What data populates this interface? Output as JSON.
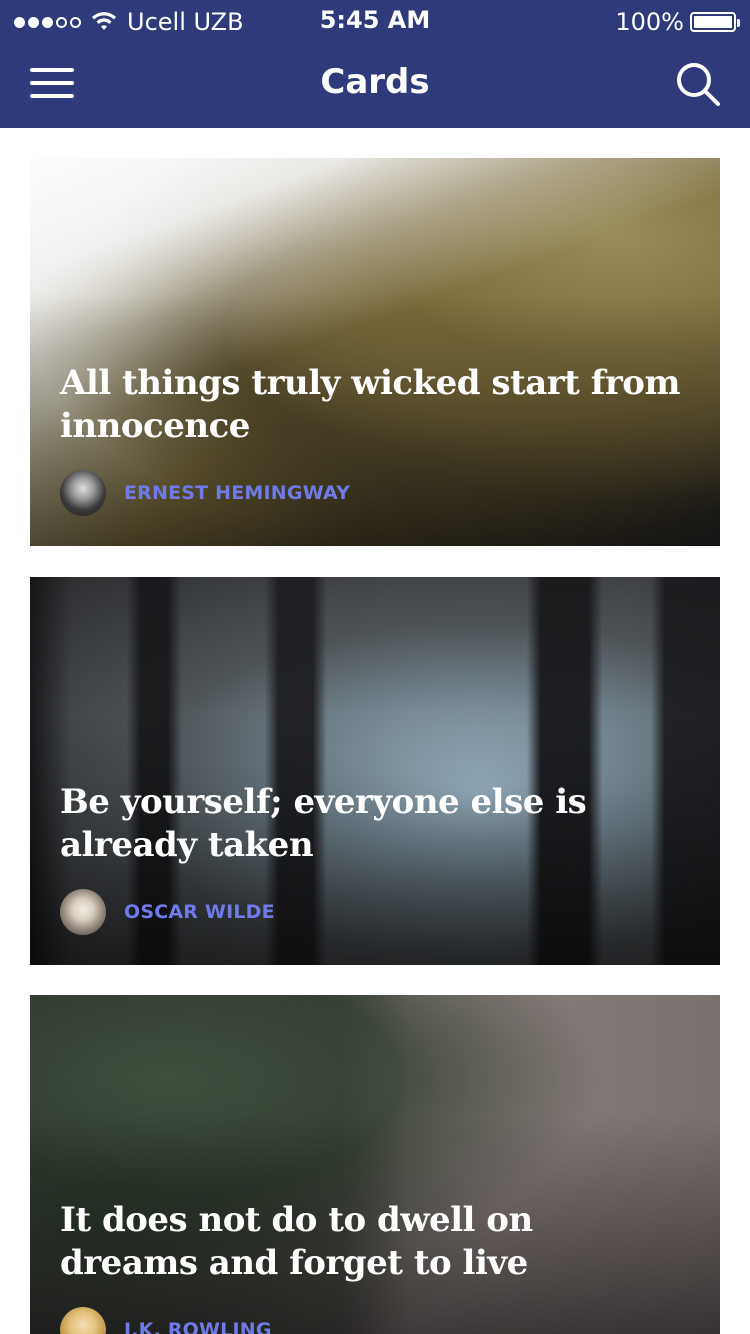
{
  "status_bar": {
    "carrier": "Ucell UZB",
    "time": "5:45 AM",
    "battery": "100%",
    "signal_bars_filled": 3,
    "signal_bars_total": 5
  },
  "navbar": {
    "title": "Cards",
    "menu_icon": "hamburger-menu-icon",
    "search_icon": "search-icon"
  },
  "colors": {
    "header_bg": "#2f3a7a",
    "author_name": "#6f7be8",
    "page_bg": "#ffffff"
  },
  "cards": [
    {
      "quote": "All things truly wicked start from innocence",
      "author": "ERNEST HEMINGWAY"
    },
    {
      "quote": "Be yourself; everyone else is already taken",
      "author": "OSCAR WILDE"
    },
    {
      "quote": "It does not do to dwell on dreams and forget to live",
      "author": "J.K. ROWLING"
    }
  ]
}
